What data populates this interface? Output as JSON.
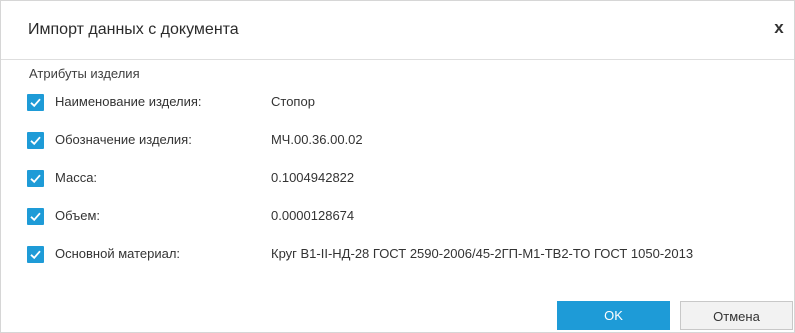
{
  "dialog": {
    "title": "Импорт данных с документа",
    "close_symbol": "x",
    "section_label": "Атрибуты изделия"
  },
  "attributes": [
    {
      "label": "Наименование изделия:",
      "value": "Стопор",
      "checked": true
    },
    {
      "label": "Обозначение изделия:",
      "value": "МЧ.00.36.00.02",
      "checked": true
    },
    {
      "label": "Масса:",
      "value": "0.1004942822",
      "checked": true
    },
    {
      "label": "Объем:",
      "value": "0.0000128674",
      "checked": true
    },
    {
      "label": "Основной материал:",
      "value": "Круг В1-II-НД-28 ГОСТ 2590-2006/45-2ГП-М1-ТВ2-ТО ГОСТ 1050-2013",
      "checked": true
    }
  ],
  "buttons": {
    "ok_label": "OK",
    "cancel_label": "Отмена"
  },
  "colors": {
    "accent": "#1e9bd7"
  }
}
